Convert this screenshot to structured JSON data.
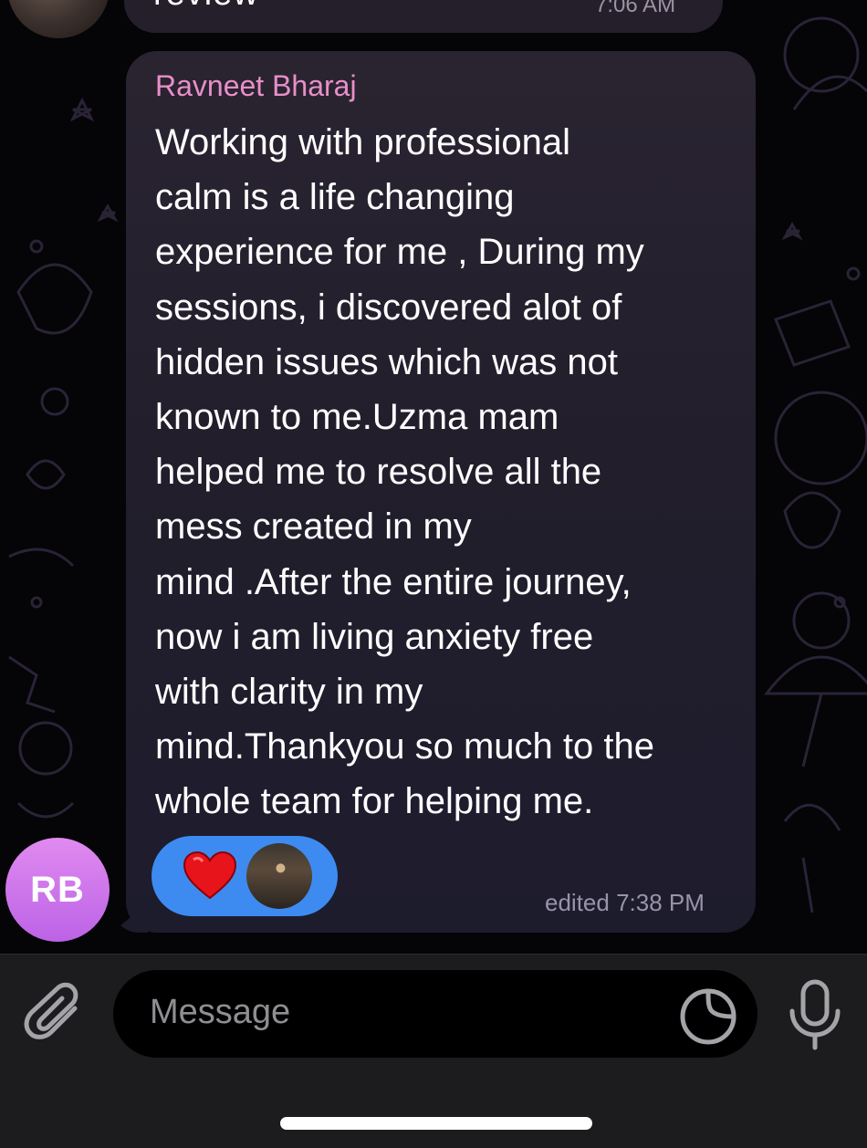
{
  "previous_message": {
    "text": "review",
    "time": "7:06 AM"
  },
  "message": {
    "sender": "Ravneet Bharaj",
    "text": "Working with professional\ncalm is a life changing\nexperience for me , During my\nsessions, i discovered alot of\nhidden issues which was not\nknown to me.Uzma mam\nhelped me to resolve all the\nmess created in my\nmind .After the entire journey,\nnow i am living anxiety free\nwith clarity in my\nmind.Thankyou so much to the\nwhole team for helping me.",
    "timestamp": "edited 7:38 PM",
    "reaction": {
      "emoji_icon": "heart-icon",
      "pill_color": "#3d8bf0"
    }
  },
  "sender_avatar": {
    "initials": "RB",
    "color": "#d47ded"
  },
  "input": {
    "placeholder": "Message",
    "attach_icon": "paperclip-icon",
    "sticker_icon": "sticker-icon",
    "mic_icon": "microphone-icon"
  },
  "colors": {
    "sender_name": "#e88fc9",
    "bubble": "#241f2e",
    "background": "#050406"
  }
}
